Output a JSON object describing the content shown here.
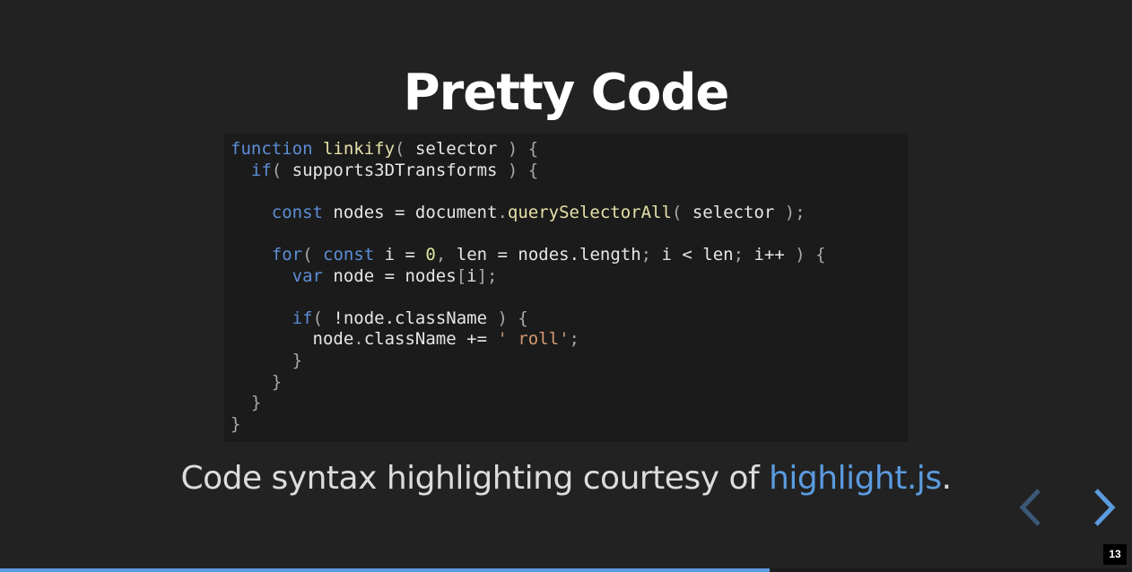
{
  "slide": {
    "title": "Pretty Code",
    "caption_text": "Code syntax highlighting courtesy of ",
    "caption_link": "highlight.js",
    "caption_end": ".",
    "slide_number": "13",
    "progress_fraction": 0.68
  },
  "colors": {
    "background": "#222222",
    "code_background": "#1b1b1b",
    "link": "#5b9bdf",
    "keyword": "#5c8ed6",
    "function_name": "#e6e0a8",
    "string": "#d39a72"
  },
  "icons": {
    "prev": "chevron-left-icon",
    "next": "chevron-right-icon"
  },
  "code": {
    "lines": [
      [
        {
          "t": "keyword",
          "v": "function"
        },
        {
          "t": "plain",
          "v": " "
        },
        {
          "t": "title",
          "v": "linkify"
        },
        {
          "t": "punct",
          "v": "("
        },
        {
          "t": "plain",
          "v": " selector "
        },
        {
          "t": "punct",
          "v": ") {"
        }
      ],
      [
        {
          "t": "plain",
          "v": "  "
        },
        {
          "t": "keyword",
          "v": "if"
        },
        {
          "t": "punct",
          "v": "("
        },
        {
          "t": "plain",
          "v": " supports3DTransforms "
        },
        {
          "t": "punct",
          "v": ") {"
        }
      ],
      [],
      [
        {
          "t": "plain",
          "v": "    "
        },
        {
          "t": "keyword",
          "v": "const"
        },
        {
          "t": "plain",
          "v": " nodes = document"
        },
        {
          "t": "punct",
          "v": "."
        },
        {
          "t": "title",
          "v": "querySelectorAll"
        },
        {
          "t": "punct",
          "v": "("
        },
        {
          "t": "plain",
          "v": " selector "
        },
        {
          "t": "punct",
          "v": ");"
        }
      ],
      [],
      [
        {
          "t": "plain",
          "v": "    "
        },
        {
          "t": "keyword",
          "v": "for"
        },
        {
          "t": "punct",
          "v": "("
        },
        {
          "t": "plain",
          "v": " "
        },
        {
          "t": "keyword",
          "v": "const"
        },
        {
          "t": "plain",
          "v": " i = "
        },
        {
          "t": "number",
          "v": "0"
        },
        {
          "t": "punct",
          "v": ","
        },
        {
          "t": "plain",
          "v": " len = nodes.length"
        },
        {
          "t": "punct",
          "v": ";"
        },
        {
          "t": "plain",
          "v": " i < len"
        },
        {
          "t": "punct",
          "v": ";"
        },
        {
          "t": "plain",
          "v": " i++ "
        },
        {
          "t": "punct",
          "v": ") {"
        }
      ],
      [
        {
          "t": "plain",
          "v": "      "
        },
        {
          "t": "keyword",
          "v": "var"
        },
        {
          "t": "plain",
          "v": " node = nodes"
        },
        {
          "t": "punct",
          "v": "["
        },
        {
          "t": "plain",
          "v": "i"
        },
        {
          "t": "punct",
          "v": "];"
        }
      ],
      [],
      [
        {
          "t": "plain",
          "v": "      "
        },
        {
          "t": "keyword",
          "v": "if"
        },
        {
          "t": "punct",
          "v": "("
        },
        {
          "t": "plain",
          "v": " !node.className "
        },
        {
          "t": "punct",
          "v": ") {"
        }
      ],
      [
        {
          "t": "plain",
          "v": "        node"
        },
        {
          "t": "punct",
          "v": "."
        },
        {
          "t": "plain",
          "v": "className += "
        },
        {
          "t": "string",
          "v": "' roll'"
        },
        {
          "t": "punct",
          "v": ";"
        }
      ],
      [
        {
          "t": "plain",
          "v": "      "
        },
        {
          "t": "punct",
          "v": "}"
        }
      ],
      [
        {
          "t": "plain",
          "v": "    "
        },
        {
          "t": "punct",
          "v": "}"
        }
      ],
      [
        {
          "t": "plain",
          "v": "  "
        },
        {
          "t": "punct",
          "v": "}"
        }
      ],
      [
        {
          "t": "punct",
          "v": "}"
        }
      ]
    ]
  }
}
